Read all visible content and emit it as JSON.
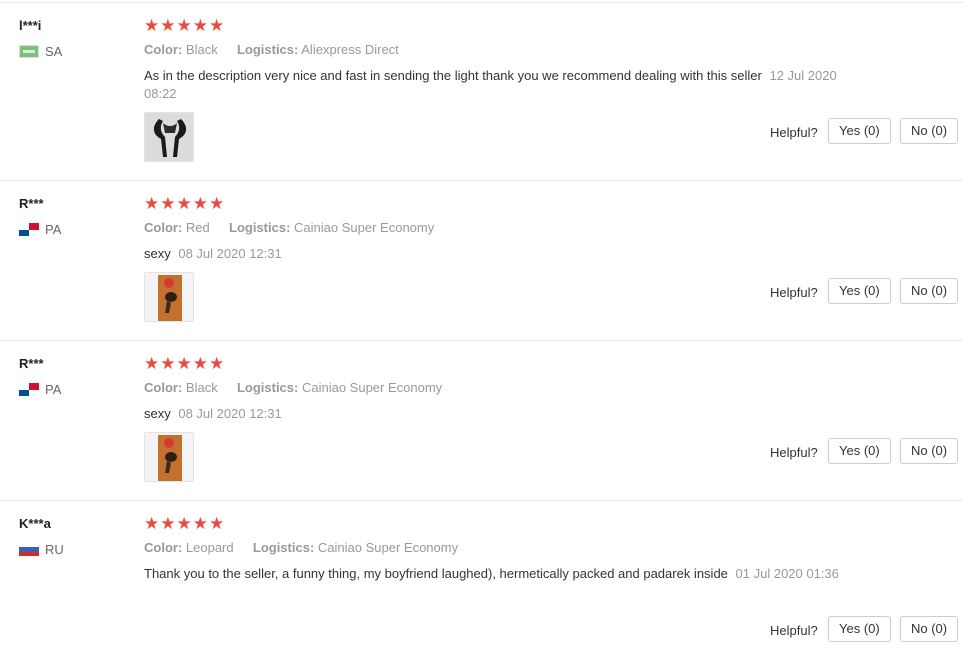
{
  "helpful_label": "Helpful?",
  "reviews": [
    {
      "user": "l***i",
      "country": "SA",
      "stars": "★★★★★",
      "color_key": "Color:",
      "color_val": "Black",
      "logistics_key": "Logistics:",
      "logistics_val": "Aliexpress Direct",
      "text": "As in the description very nice and fast in sending the light thank you we recommend dealing with this seller",
      "date": "12 Jul 2020 08:22",
      "yes": "Yes (0)",
      "no": "No (0)"
    },
    {
      "user": "R***",
      "country": "PA",
      "stars": "★★★★★",
      "color_key": "Color:",
      "color_val": "Red",
      "logistics_key": "Logistics:",
      "logistics_val": "Cainiao Super Economy",
      "text": "sexy",
      "date": "08 Jul 2020 12:31",
      "yes": "Yes (0)",
      "no": "No (0)"
    },
    {
      "user": "R***",
      "country": "PA",
      "stars": "★★★★★",
      "color_key": "Color:",
      "color_val": "Black",
      "logistics_key": "Logistics:",
      "logistics_val": "Cainiao Super Economy",
      "text": "sexy",
      "date": "08 Jul 2020 12:31",
      "yes": "Yes (0)",
      "no": "No (0)"
    },
    {
      "user": "K***a",
      "country": "RU",
      "stars": "★★★★★",
      "color_key": "Color:",
      "color_val": "Leopard",
      "logistics_key": "Logistics:",
      "logistics_val": "Cainiao Super Economy",
      "text": "Thank you to the seller, a funny thing, my boyfriend laughed), hermetically packed and padarek inside",
      "date": "01 Jul 2020 01:36",
      "yes": "Yes (0)",
      "no": "No (0)"
    }
  ]
}
